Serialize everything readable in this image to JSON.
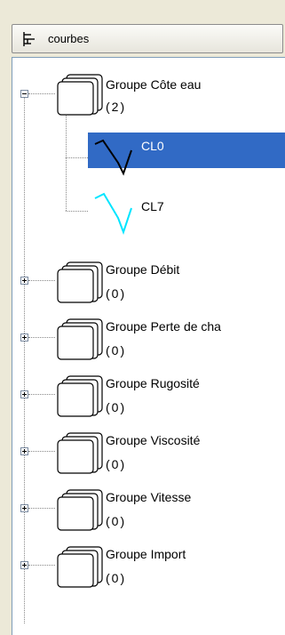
{
  "header": {
    "label": "courbes"
  },
  "tree": {
    "expanded_group": {
      "name": "Groupe Côte eau",
      "count": "(2)",
      "children": [
        {
          "label": "CL0",
          "curve_color": "#000000",
          "selected": true
        },
        {
          "label": "CL7",
          "curve_color": "#00e5ff",
          "selected": false
        }
      ]
    },
    "collapsed_groups": [
      {
        "name": "Groupe Débit",
        "count": "(0)"
      },
      {
        "name": "Groupe Perte de cha",
        "count": "(0)"
      },
      {
        "name": "Groupe Rugosité",
        "count": "(0)"
      },
      {
        "name": "Groupe Viscosité",
        "count": "(0)"
      },
      {
        "name": "Groupe Vitesse",
        "count": "(0)"
      },
      {
        "name": "Groupe Import",
        "count": "(0)"
      }
    ]
  },
  "colors": {
    "selection": "#316ac5",
    "panel_bg": "#ece9d8",
    "tree_bg": "#ffffff"
  }
}
